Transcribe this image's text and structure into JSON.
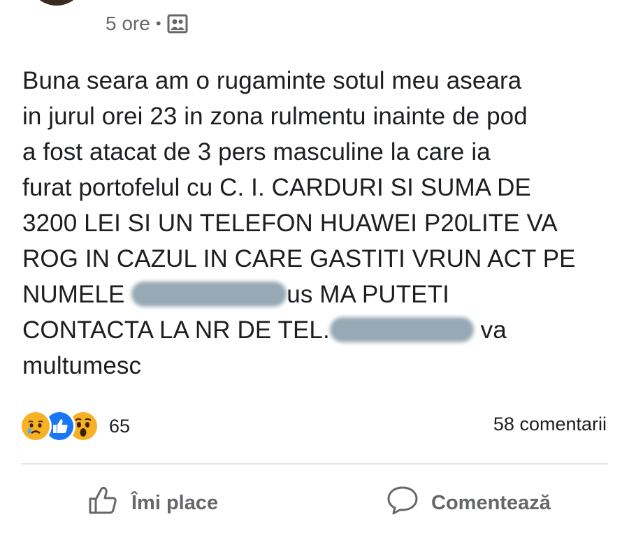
{
  "header": {
    "time": "5 ore",
    "separator": "•",
    "privacy_icon": "friends-icon"
  },
  "post": {
    "lines": {
      "l1": "Buna seara am o rugaminte sotul meu aseara",
      "l2": "in jurul orei 23 in zona rulmentu inainte de pod",
      "l3": "a fost atacat de 3 pers masculine la care ia",
      "l4": "furat portofelul cu C. I. CARDURI SI SUMA DE",
      "l5": "3200 LEI SI UN TELEFON HUAWEI P20LITE  VA",
      "l6": "ROG IN CAZUL IN CARE GASTITI VRUN ACT PE",
      "l7_start": "NUMELE ",
      "l7_end": "us MA PUTETI",
      "l8_start": "CONTACTA LA NR DE TEL.",
      "l8_end": " va",
      "l9": "multumesc"
    }
  },
  "stats": {
    "reaction_icons": [
      "sad-reaction-icon",
      "like-reaction-icon",
      "wow-reaction-icon"
    ],
    "reaction_count": "65",
    "comments": "58 comentarii"
  },
  "actions": {
    "like_label": "Îmi place",
    "comment_label": "Comentează"
  },
  "colors": {
    "secondary_text": "#65676b",
    "like_blue": "#1877f2",
    "reaction_yellow": "#f7b125",
    "divider": "#e4e6eb"
  }
}
